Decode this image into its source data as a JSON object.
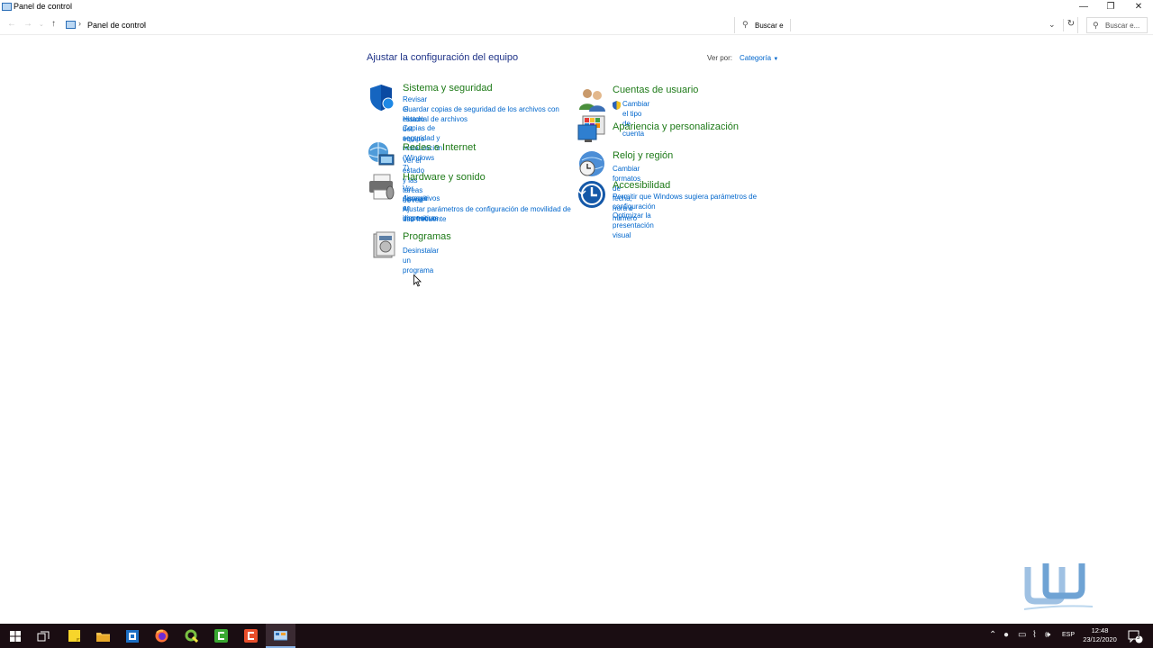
{
  "window": {
    "title": "Panel de control",
    "minimize": "—",
    "maximize": "❐",
    "close": "✕"
  },
  "address_bar": {
    "breadcrumb": "Panel de control",
    "search_value": "Buscar e",
    "right_search_placeholder": "Buscar e..."
  },
  "main": {
    "heading": "Ajustar la configuración del equipo",
    "view_by_label": "Ver por:",
    "view_by_value": "Categoría"
  },
  "categories_left": [
    {
      "title": "Sistema y seguridad",
      "icon": "shield-icon",
      "links": [
        "Revisar el estado del equipo",
        "Guardar copias de seguridad de los archivos con Historial de archivos",
        "Copias de seguridad y restauración (Windows 7)"
      ]
    },
    {
      "title": "Redes e Internet",
      "icon": "network-icon",
      "links": [
        "Ver el estado y las tareas de red"
      ]
    },
    {
      "title": "Hardware y sonido",
      "icon": "printer-icon",
      "links": [
        "Ver dispositivos e impresoras",
        "Agregar un dispositivo",
        "Ajustar parámetros de configuración de movilidad de uso frecuente"
      ]
    },
    {
      "title": "Programas",
      "icon": "programs-icon",
      "links": [
        "Desinstalar un programa"
      ]
    }
  ],
  "categories_right": [
    {
      "title": "Cuentas de usuario",
      "icon": "users-icon",
      "links": [
        "Cambiar el tipo de cuenta"
      ]
    },
    {
      "title": "Apariencia y personalización",
      "icon": "monitor-icon",
      "links": []
    },
    {
      "title": "Reloj y región",
      "icon": "clock-globe-icon",
      "links": [
        "Cambiar formatos de fecha, hora o número"
      ]
    },
    {
      "title": "Accesibilidad",
      "icon": "accessibility-icon",
      "links": [
        "Permitir que Windows sugiera parámetros de configuración",
        "Optimizar la presentación visual"
      ]
    }
  ],
  "taskbar": {
    "language": "ESP",
    "time": "12:48",
    "date": "23/12/2020",
    "notification_count": "3",
    "apps": [
      "start-icon",
      "task-view-icon",
      "sticky-notes-icon",
      "file-explorer-icon",
      "app-icon",
      "firefox-icon",
      "qgis-icon",
      "camtasia-icon",
      "recorder-icon",
      "control-panel-icon"
    ]
  },
  "colors": {
    "heading": "#1e3287",
    "category_title": "#1e7a18",
    "link": "#0066cc",
    "taskbar": "#1a0d12"
  }
}
